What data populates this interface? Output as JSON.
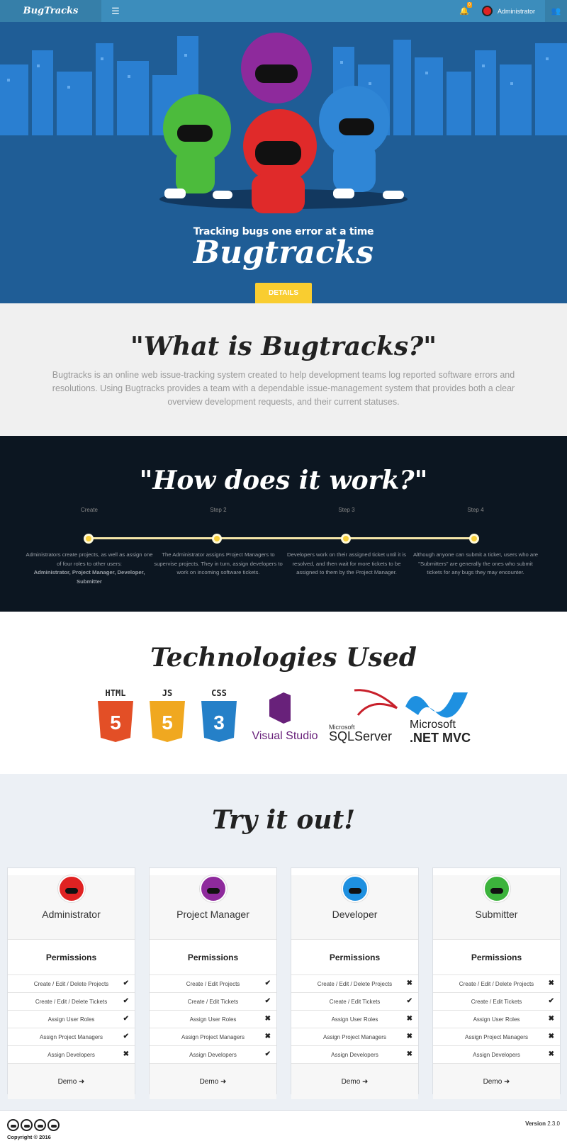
{
  "nav": {
    "brand": "BugTracks",
    "menu_icon": "☰",
    "bell_icon": "bell-icon",
    "bell_count": "0",
    "username": "Administrator"
  },
  "hero": {
    "tagline": "Tracking bugs one error at a time",
    "title": "Bugtracks",
    "details_label": "DETAILS"
  },
  "what": {
    "heading": "\"What is Bugtracks?\"",
    "body": "Bugtracks is an online web issue-tracking system created to help development teams log reported software errors and resolutions. Using Bugtracks provides a team with a dependable issue-management system that provides both a clear overview development requests, and their current statuses."
  },
  "how": {
    "heading": "\"How does it work?\"",
    "steps": [
      {
        "label": "Create",
        "desc": "Administrators create projects, as well as assign one of four roles to other users:",
        "bold": "Administrator, Project Manager, Developer, Submitter"
      },
      {
        "label": "Step 2",
        "desc": "The Administrator assigns Project Managers to supervise projects. They in turn, assign developers to work on incoming software tickets.",
        "bold": ""
      },
      {
        "label": "Step 3",
        "desc": "Developers work on their assigned ticket until it is resolved, and then wait for more tickets to be assigned to them by the Project Manager.",
        "bold": ""
      },
      {
        "label": "Step 4",
        "desc": "Although anyone can submit a ticket, users who are \"Submitters\" are generally the ones who submit tickets for any bugs they may encounter.",
        "bold": ""
      }
    ]
  },
  "tech": {
    "heading": "Technologies Used",
    "logos": [
      "HTML",
      "JS",
      "CSS",
      "Visual Studio",
      "Microsoft",
      "SQLServer",
      "Microsoft",
      "®",
      ".NET MVC"
    ]
  },
  "try": {
    "heading": "Try it out!",
    "permissions_label": "Permissions",
    "demo_label": "Demo ➜",
    "roles": [
      {
        "name": "Administrator",
        "color": "#e02222",
        "perms": [
          "Create / Edit / Delete Projects",
          "Create / Edit / Delete Tickets",
          "Assign User Roles",
          "Assign Project Managers",
          "Assign Developers"
        ],
        "marks": [
          "✔",
          "✔",
          "✔",
          "✔",
          "✖"
        ]
      },
      {
        "name": "Project Manager",
        "color": "#8e2a9c",
        "perms": [
          "Create / Edit Projects",
          "Create / Edit Tickets",
          "Assign User Roles",
          "Assign Project Managers",
          "Assign Developers"
        ],
        "marks": [
          "✔",
          "✔",
          "✖",
          "✖",
          "✔"
        ]
      },
      {
        "name": "Developer",
        "color": "#1e90e0",
        "perms": [
          "Create / Edit / Delete Projects",
          "Create / Edit Tickets",
          "Assign User Roles",
          "Assign Project Managers",
          "Assign Developers"
        ],
        "marks": [
          "✖",
          "✔",
          "✖",
          "✖",
          "✖"
        ]
      },
      {
        "name": "Submitter",
        "color": "#3cb33c",
        "perms": [
          "Create / Edit / Delete Projects",
          "Create / Edit Tickets",
          "Assign User Roles",
          "Assign Project Managers",
          "Assign Developers"
        ],
        "marks": [
          "✖",
          "✔",
          "✖",
          "✖",
          "✖"
        ]
      }
    ]
  },
  "footer": {
    "copyright": "Copyright © 2016",
    "version_label": "Version",
    "version": "2.3.0"
  }
}
